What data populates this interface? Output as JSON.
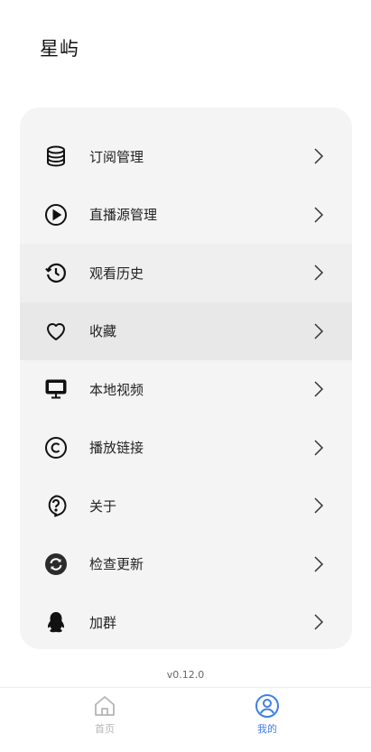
{
  "header": {
    "title": "星屿"
  },
  "menu": {
    "items": [
      {
        "label": "订阅管理",
        "icon": "database-icon"
      },
      {
        "label": "直播源管理",
        "icon": "play-circle-icon"
      },
      {
        "label": "观看历史",
        "icon": "history-icon"
      },
      {
        "label": "收藏",
        "icon": "heart-icon"
      },
      {
        "label": "本地视频",
        "icon": "monitor-icon"
      },
      {
        "label": "播放链接",
        "icon": "copyright-link-icon"
      },
      {
        "label": "关于",
        "icon": "question-icon"
      },
      {
        "label": "检查更新",
        "icon": "refresh-icon"
      },
      {
        "label": "加群",
        "icon": "qq-penguin-icon"
      }
    ]
  },
  "footer": {
    "version": "v0.12.0"
  },
  "tabs": {
    "home": {
      "label": "首页",
      "icon": "home-icon"
    },
    "mine": {
      "label": "我的",
      "icon": "user-circle-icon"
    }
  },
  "colors": {
    "accent": "#3f7ee8",
    "card_bg": "#f4f4f4",
    "inactive_tab": "#b5b5b5"
  }
}
